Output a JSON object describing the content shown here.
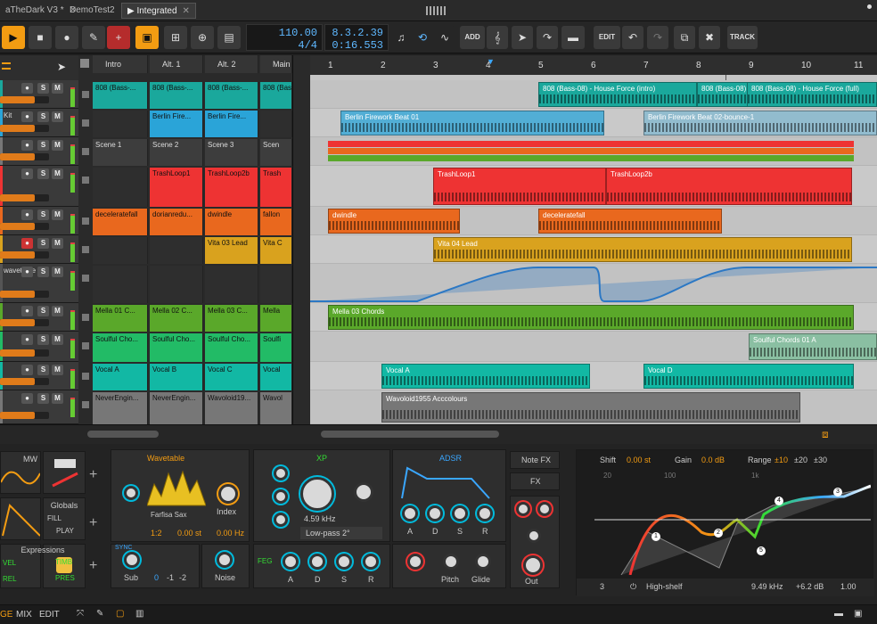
{
  "tabs": [
    {
      "label": "aTheDark V3 *"
    },
    {
      "label": "DemoTest2"
    },
    {
      "label": "Integrated"
    }
  ],
  "toolbar": {
    "tempo": "110.00",
    "meter": "4/4",
    "position": "8.3.2.39",
    "time": "0:16.553",
    "add": "ADD",
    "edit": "EDIT",
    "track": "TRACK"
  },
  "scenes": [
    "Intro",
    "Alt. 1",
    "Alt. 2",
    "Main"
  ],
  "tracks": [
    {
      "name": "",
      "color": "#1aa89c"
    },
    {
      "name": "Kit",
      "color": "#2aa4d8"
    },
    {
      "name": "",
      "color": "#777"
    },
    {
      "name": "",
      "color": "#e33"
    },
    {
      "name": "",
      "color": "#e9681e"
    },
    {
      "name": "",
      "color": "#d9a21e"
    },
    {
      "name": "wavetable",
      "color": "#555"
    },
    {
      "name": "",
      "color": "#5aa82a"
    },
    {
      "name": "",
      "color": "#22bb66"
    },
    {
      "name": "",
      "color": "#12b8a4"
    },
    {
      "name": "",
      "color": "#777"
    }
  ],
  "launcher_cells": [
    [
      "808 (Bass-...",
      "808 (Bass-...",
      "808 (Bass-...",
      "808 (Bas"
    ],
    [
      "",
      "Berlin Fire...",
      "Berlin Fire...",
      ""
    ],
    [
      "Scene 1",
      "Scene 2",
      "Scene 3",
      "Scen"
    ],
    [
      "",
      "TrashLoop1",
      "TrashLoop2b",
      "Trash"
    ],
    [
      "deceleratefall",
      "dorianredu...",
      "dwindle",
      "fallon"
    ],
    [
      "",
      "",
      "Vita 03 Lead",
      "Vita C"
    ],
    [
      "",
      "",
      "",
      ""
    ],
    [
      "Mella 01 C...",
      "Mella 02 C...",
      "Mella 03 C...",
      "Mella"
    ],
    [
      "Soulful Cho...",
      "Soulful Cho...",
      "Soulful Cho...",
      "Soulfi"
    ],
    [
      "Vocal A",
      "Vocal B",
      "Vocal C",
      "Vocal"
    ],
    [
      "NeverEngin...",
      "NeverEngin...",
      "Wavoloid19...",
      "Wavol"
    ]
  ],
  "ruler": [
    "1",
    "2",
    "3",
    "4",
    "5",
    "6",
    "7",
    "8",
    "9",
    "10",
    "11"
  ],
  "arr_clips": [
    {
      "label": "808 (Bass-08) - House Force (intro)",
      "lane": 0
    },
    {
      "label": "808 (Bass-08)",
      "lane": 0
    },
    {
      "label": "808 (Bass-08) - House Force (full)",
      "lane": 0
    },
    {
      "label": "Berlin Firework Beat 01",
      "lane": 1
    },
    {
      "label": "Berlin Firework Beat 02-bounce-1",
      "lane": 1
    },
    {
      "label": "TrashLoop1",
      "lane": 3
    },
    {
      "label": "TrashLoop2b",
      "lane": 3
    },
    {
      "label": "dwindle",
      "lane": 4
    },
    {
      "label": "deceleratefall",
      "lane": 4
    },
    {
      "label": "Vita 04 Lead",
      "lane": 5
    },
    {
      "label": "Mella 03 Chords",
      "lane": 7
    },
    {
      "label": "Soulful Chords 01 A",
      "lane": 8
    },
    {
      "label": "Vocal A",
      "lane": 9
    },
    {
      "label": "Vocal D",
      "lane": 9
    },
    {
      "label": "Wavoloid1955 Acccolours",
      "lane": 10
    }
  ],
  "devices": {
    "mw": "MW",
    "globals": "Globals",
    "fill": "FILL",
    "play": "PLAY",
    "expressions": "Expressions",
    "vel": "VEL",
    "timb": "TIMB",
    "rel": "REL",
    "pres": "PRES",
    "wavetable": "Wavetable",
    "wt_name": "Farfisa Sax",
    "index": "Index",
    "ratio": "1:2",
    "st": "0.00 st",
    "hz": "0.00 Hz",
    "sync": "SYNC",
    "sub": "Sub",
    "noise": "Noise",
    "oct": [
      "0",
      "-1",
      "-2"
    ],
    "xp": "XP",
    "cutoff": "4.59 kHz",
    "filter": "Low-pass 2°",
    "feg": "FEG",
    "adsr": "ADSR",
    "a": "A",
    "d": "D",
    "s": "S",
    "r": "R",
    "notefx": "Note FX",
    "fx": "FX",
    "pitch": "Pitch",
    "glide": "Glide",
    "out": "Out",
    "eq_shift": "Shift",
    "eq_shift_val": "0.00 st",
    "eq_gain": "Gain",
    "eq_gain_val": "0.0 dB",
    "eq_range": "Range",
    "ranges": [
      "±10",
      "±20",
      "±30"
    ],
    "band": "High-shelf",
    "freq": "9.49 kHz",
    "gain_db": "+6.2 dB",
    "q": "1.00",
    "band_no": "3",
    "freq_ticks": [
      "20",
      "100",
      "1k"
    ]
  },
  "bottom": {
    "mix": "MIX",
    "edit": "EDIT",
    "ge": "GE"
  }
}
